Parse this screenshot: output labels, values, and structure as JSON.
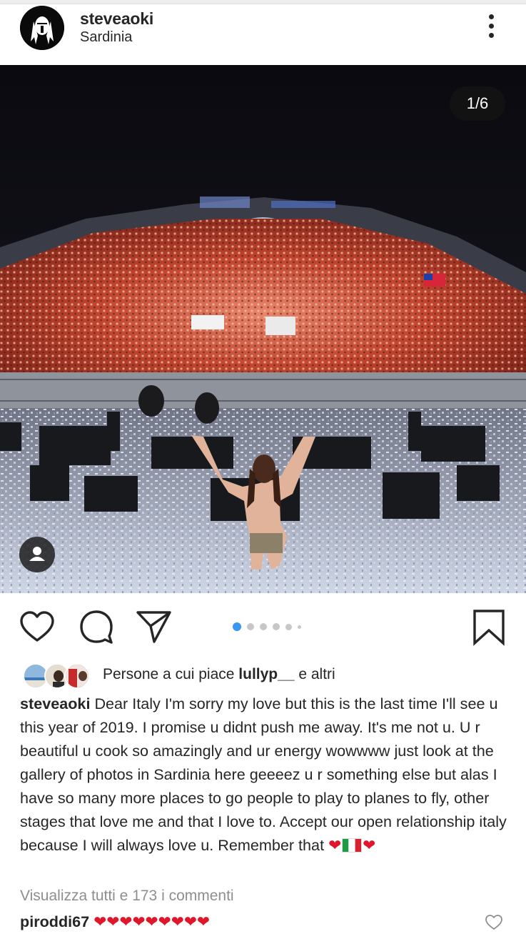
{
  "post": {
    "username": "steveaoki",
    "location": "Sardinia",
    "photo_counter": "1/6",
    "carousel_dots": 6,
    "carousel_active": 0
  },
  "likes": {
    "prefix": "Persone a cui piace ",
    "user": "lullyp__",
    "suffix": " e altri"
  },
  "caption": {
    "username": "steveaoki",
    "text": "Dear Italy I'm sorry my love but this is the last time I'll see u this year of 2019. I promise u didnt push me away. It's me not u. U r beautiful u cook so amazingly and ur energy wowwww just look at the gallery of photos in Sardinia here geeeez u r something else but alas I have so many more places to go people to play to planes to fly, other stages that love me and that I love to. Accept our open relationship italy because I will always love u. Remember that",
    "heart_left": "❤",
    "heart_right": "❤"
  },
  "view_comments": "Visualizza tutti e 173 i commenti",
  "comment": {
    "username": "piroddi67",
    "text": "❤❤❤❤❤❤❤❤❤"
  },
  "icons": {
    "like": "heart-icon",
    "comment": "comment-bubble-icon",
    "share": "paper-plane-icon",
    "save": "bookmark-icon",
    "more": "more-vertical-icon",
    "tag": "user-tag-icon"
  },
  "colors": {
    "text": "#262626",
    "muted": "#8e8e8e",
    "active_dot": "#3897f0",
    "heart": "#e0162b"
  }
}
